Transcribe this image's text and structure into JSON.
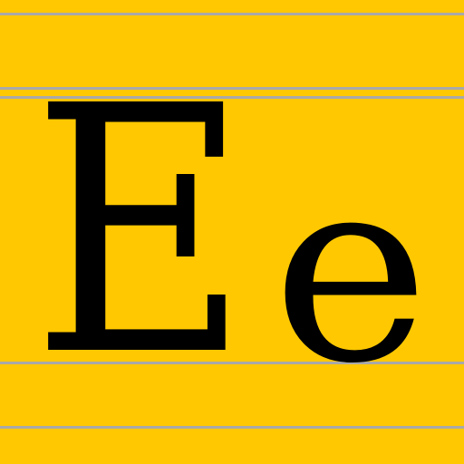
{
  "glyph": {
    "upper": "E",
    "lower": "e"
  },
  "colors": {
    "background": "#ffc800",
    "rule_lines": "#a9a9a9",
    "letters": "#000000"
  }
}
